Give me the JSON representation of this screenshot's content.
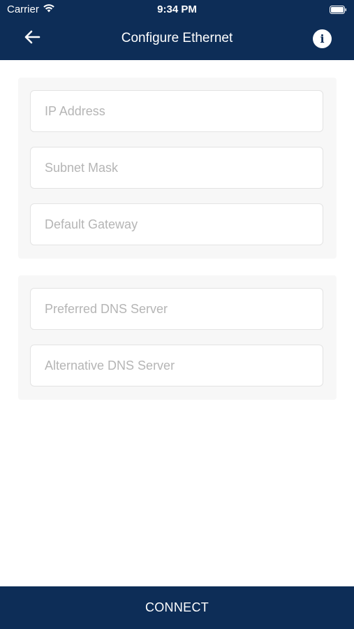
{
  "status_bar": {
    "carrier": "Carrier",
    "time": "9:34 PM",
    "wifi_icon": "wifi-icon",
    "battery_icon": "battery-icon"
  },
  "nav": {
    "title": "Configure Ethernet",
    "back_icon": "arrow-left-icon",
    "info_icon": "info-icon",
    "info_glyph": "i"
  },
  "form": {
    "ip_group": {
      "fields": [
        {
          "placeholder": "IP Address",
          "value": ""
        },
        {
          "placeholder": "Subnet Mask",
          "value": ""
        },
        {
          "placeholder": "Default Gateway",
          "value": ""
        }
      ]
    },
    "dns_group": {
      "fields": [
        {
          "placeholder": "Preferred DNS Server",
          "value": ""
        },
        {
          "placeholder": "Alternative DNS Server",
          "value": ""
        }
      ]
    }
  },
  "footer": {
    "connect_label": "CONNECT"
  },
  "colors": {
    "primary": "#0d2d57",
    "group_background": "#f7f7f7",
    "field_border": "#e3e3e3",
    "placeholder": "#b5b5b5"
  }
}
